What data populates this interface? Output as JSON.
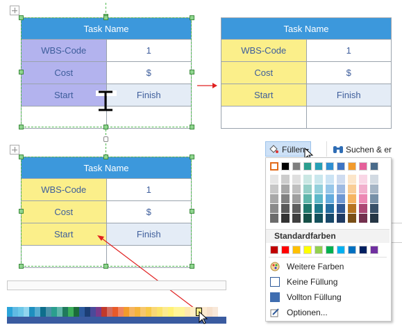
{
  "tables": {
    "header": "Task Name",
    "rows": [
      {
        "label": "WBS-Code",
        "value": "1"
      },
      {
        "label": "Cost",
        "value": "$"
      },
      {
        "label": "Start",
        "value": "Finish"
      }
    ]
  },
  "ribbon": {
    "fill_label": "Füllen",
    "search_label": "Suchen & er"
  },
  "color_menu": {
    "section_title": "Standardfarben",
    "items": {
      "more_colors": "Weitere Farben",
      "no_fill": "Keine Füllung",
      "solid_fill": "Vollton Füllung",
      "options": "Optionen..."
    },
    "theme_top": [
      "#ffffff",
      "#000000",
      "#7f7f7f",
      "#2b9e8e",
      "#27a0b6",
      "#2f8fd2",
      "#3d74c4",
      "#f29b2c",
      "#e5609a",
      "#4a6b8a"
    ],
    "standard": [
      "#c00000",
      "#ff0000",
      "#ffc000",
      "#ffff00",
      "#92d050",
      "#00b050",
      "#00b0f0",
      "#0070c0",
      "#002060",
      "#7030a0"
    ]
  },
  "colors": {
    "header_blue": "#3c98dc",
    "highlight_purple": "#b3b3ee",
    "highlight_yellow": "#fbef8a",
    "finish_blue": "#e4ecf6",
    "arrow_red": "#e02020"
  }
}
